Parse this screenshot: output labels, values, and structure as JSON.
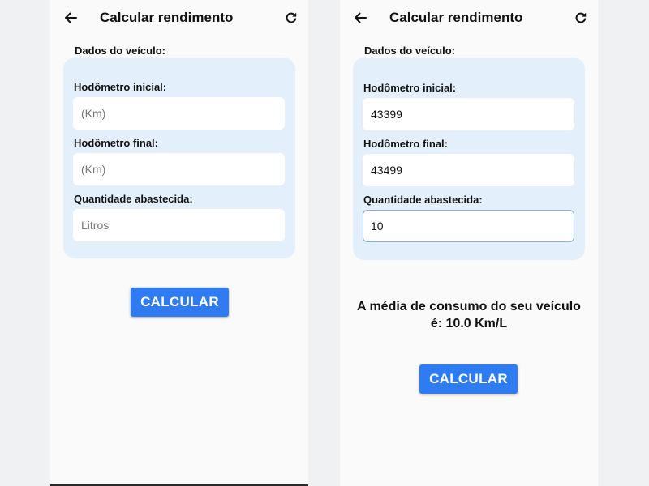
{
  "app": {
    "title": "Calcular rendimento",
    "back_icon": "arrow-left-icon",
    "refresh_icon": "refresh-icon"
  },
  "colors": {
    "accent": "#2f7cf2",
    "card_background": "#e3f0fc",
    "screen_background": "#fafafa",
    "page_background": "#f0f1f3"
  },
  "screens": {
    "left": {
      "section_label": "Dados do veículo:",
      "odometer_start": {
        "label": "Hodômetro inicial:",
        "placeholder": "(Km)",
        "value": ""
      },
      "odometer_end": {
        "label": "Hodômetro final:",
        "placeholder": "(Km)",
        "value": ""
      },
      "fuel_quantity": {
        "label": "Quantidade abastecida:",
        "placeholder": "Litros",
        "value": ""
      },
      "calculate_label": "CALCULAR"
    },
    "right": {
      "section_label": "Dados do veículo:",
      "odometer_start": {
        "label": "Hodômetro inicial:",
        "placeholder": "(Km)",
        "value": "43399"
      },
      "odometer_end": {
        "label": "Hodômetro final:",
        "placeholder": "(Km)",
        "value": "43499"
      },
      "fuel_quantity": {
        "label": "Quantidade abastecida:",
        "placeholder": "Litros",
        "value": "10"
      },
      "result_line1": "A média de consumo do seu veículo",
      "result_line2": "é: 10.0 Km/L",
      "calculate_label": "CALCULAR"
    }
  }
}
